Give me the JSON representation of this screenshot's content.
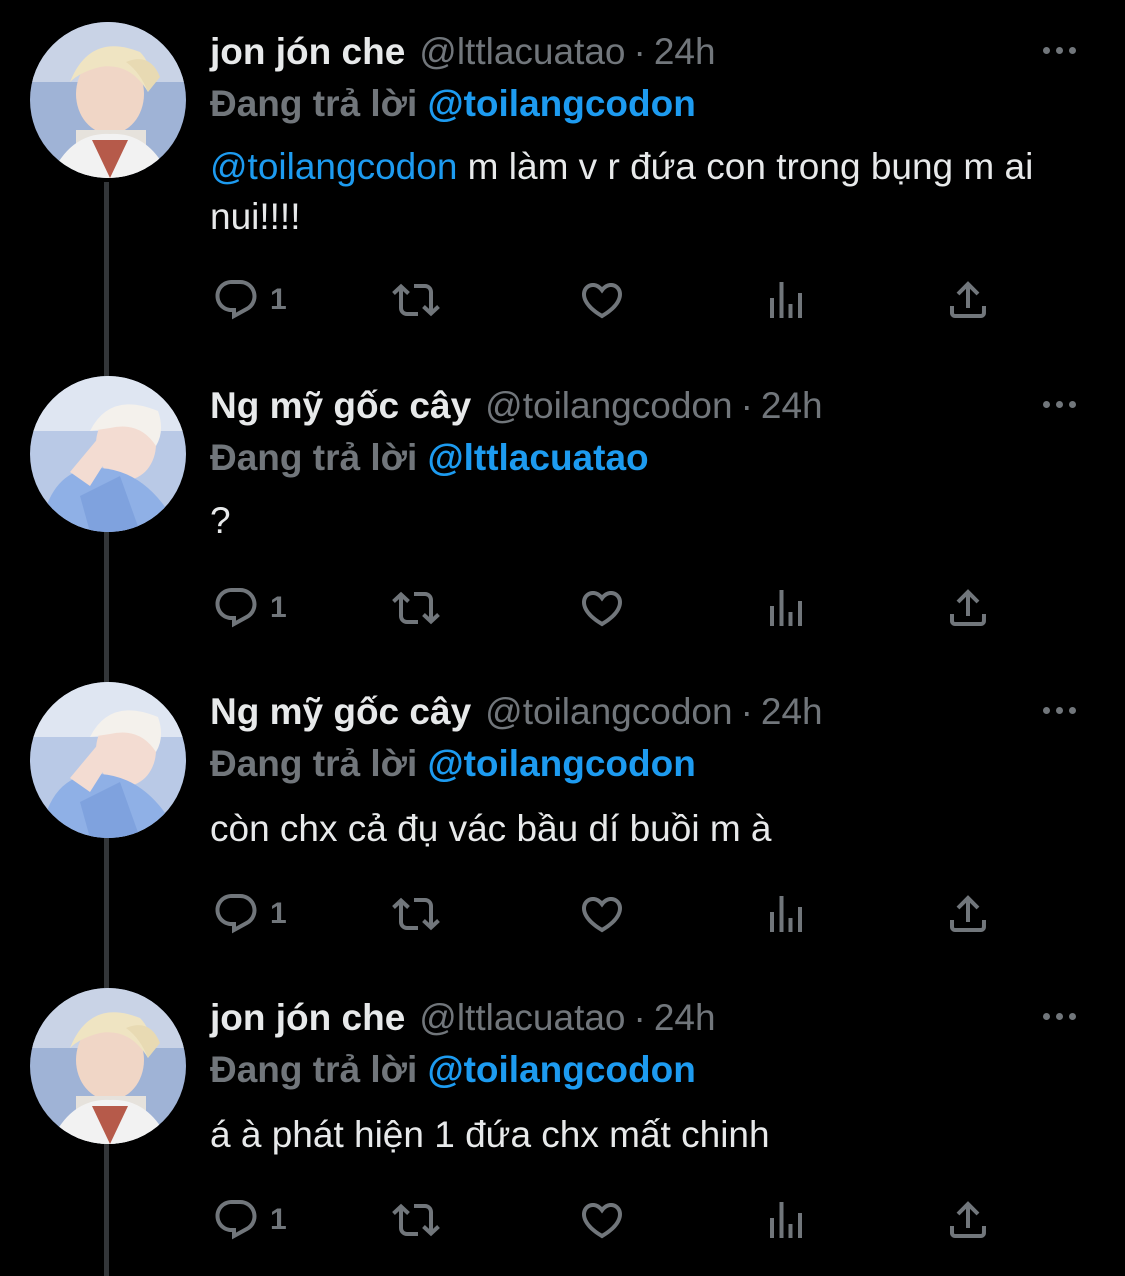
{
  "colors": {
    "background": "#000000",
    "text": "#e7e9ea",
    "muted": "#71767b",
    "accent": "#1d9bf0",
    "thread_line": "#333639"
  },
  "tweets": [
    {
      "name": "jon jón che",
      "handle": "@lttlacuatao",
      "separator": "·",
      "time": "24h",
      "reply_label": "Đang trả lời",
      "reply_to": "@toilangcodon",
      "body_mention": "@toilangcodon",
      "body_text": " m làm v r đứa con trong bụng m ai nui!!!!",
      "reply_count": "1",
      "avatar": "avatar-blonde"
    },
    {
      "name": "Ng mỹ gốc cây",
      "handle": "@toilangcodon",
      "separator": "·",
      "time": "24h",
      "reply_label": "Đang trả lời",
      "reply_to": "@lttlacuatao",
      "body_mention": "",
      "body_text": "?",
      "reply_count": "1",
      "avatar": "avatar-light-blue"
    },
    {
      "name": "Ng mỹ gốc cây",
      "handle": "@toilangcodon",
      "separator": "·",
      "time": "24h",
      "reply_label": "Đang trả lời",
      "reply_to": "@toilangcodon",
      "body_mention": "",
      "body_text": "còn chx cả đụ vác bầu dí buồi m à",
      "reply_count": "1",
      "avatar": "avatar-light-blue"
    },
    {
      "name": "jon jón che",
      "handle": "@lttlacuatao",
      "separator": "·",
      "time": "24h",
      "reply_label": "Đang trả lời",
      "reply_to": "@toilangcodon",
      "body_mention": "",
      "body_text": "á à phát hiện 1 đứa chx mất chinh",
      "reply_count": "1",
      "avatar": "avatar-blonde"
    }
  ],
  "action_icons": [
    "reply-icon",
    "retweet-icon",
    "like-icon",
    "analytics-icon",
    "share-icon"
  ]
}
